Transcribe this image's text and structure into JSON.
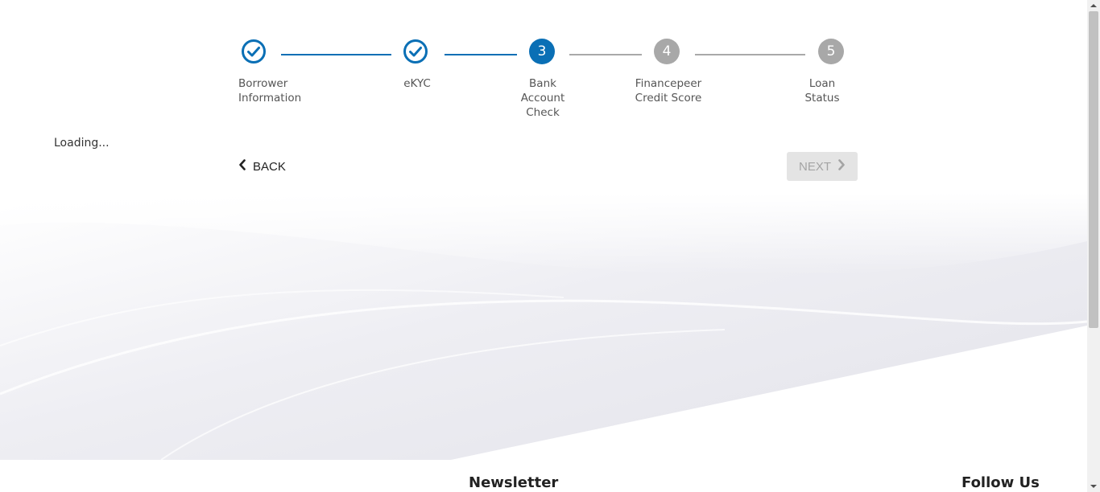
{
  "stepper": {
    "steps": [
      {
        "number": "1",
        "label": "Borrower\nInformation",
        "state": "done"
      },
      {
        "number": "2",
        "label": "eKYC",
        "state": "done"
      },
      {
        "number": "3",
        "label": "Bank\nAccount\nCheck",
        "state": "active"
      },
      {
        "number": "4",
        "label": "Financepeer\nCredit Score",
        "state": "pending"
      },
      {
        "number": "5",
        "label": "Loan\nStatus",
        "state": "pending"
      }
    ]
  },
  "status": {
    "loading_text": "Loading..."
  },
  "nav": {
    "back_label": "BACK",
    "next_label": "NEXT",
    "back_icon": "chevron-left-icon",
    "next_icon": "chevron-right-icon"
  },
  "footer": {
    "newsletter_heading": "Newsletter",
    "follow_heading": "Follow Us"
  },
  "colors": {
    "accent": "#0a6fb5",
    "pending": "#a8a8a8",
    "next_disabled_bg": "#e4e4e4"
  }
}
